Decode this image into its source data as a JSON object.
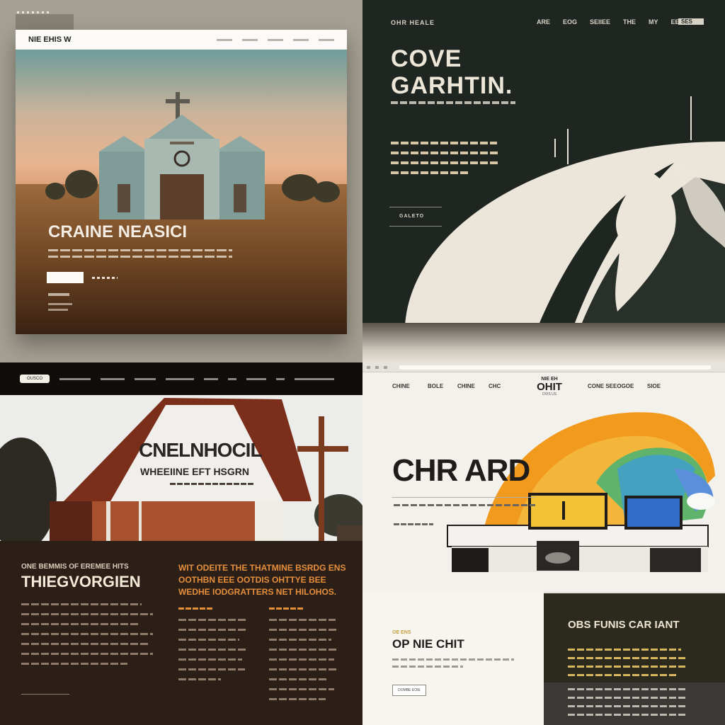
{
  "q1": {
    "logo": "NIE EHIS W",
    "hero_title": "CRAINE NEASICI"
  },
  "q2": {
    "brand": "OHR HEALE",
    "nav": [
      "ARE",
      "EOG",
      "SEIIEE",
      "THE",
      "MY",
      "EE"
    ],
    "nav_button": "SES",
    "title_line1": "COVE",
    "title_line2": "GARHTIN.",
    "button": "GALETO"
  },
  "q3": {
    "pill_label": "OUSCO",
    "barn_line1": "CNELNHOCIL",
    "barn_line2": "WHEEIINE EFT HSGRN",
    "eyebrow": "ONE BEMMIS OF EREMEE HITS",
    "heading": "THIEGVORGIEN",
    "quote_line1": "WIT ODEITE THE THATMINE BSRDG ENS",
    "quote_line2": "OOTHBN EEE OOTDIS OHTTYE BEE",
    "quote_line3": "WEDHE IODGRATTERS NET HILOHOS."
  },
  "q4": {
    "nav_left": [
      "CHINE",
      "BOLE",
      "CHINE",
      "CHC"
    ],
    "logo_top": "NIE EH",
    "logo_main": "OHIT",
    "logo_bottom": "OVIS US",
    "nav_right": [
      "CONE SEEOGOE",
      "SIOE"
    ],
    "hero_title": "CHR ARD",
    "eyebrow": "OE ENS",
    "sub_title": "OP NIE CHIT",
    "sub_button": "DOMBE EOIE",
    "panel_title": "OBS FUNIS CAR IANT"
  }
}
